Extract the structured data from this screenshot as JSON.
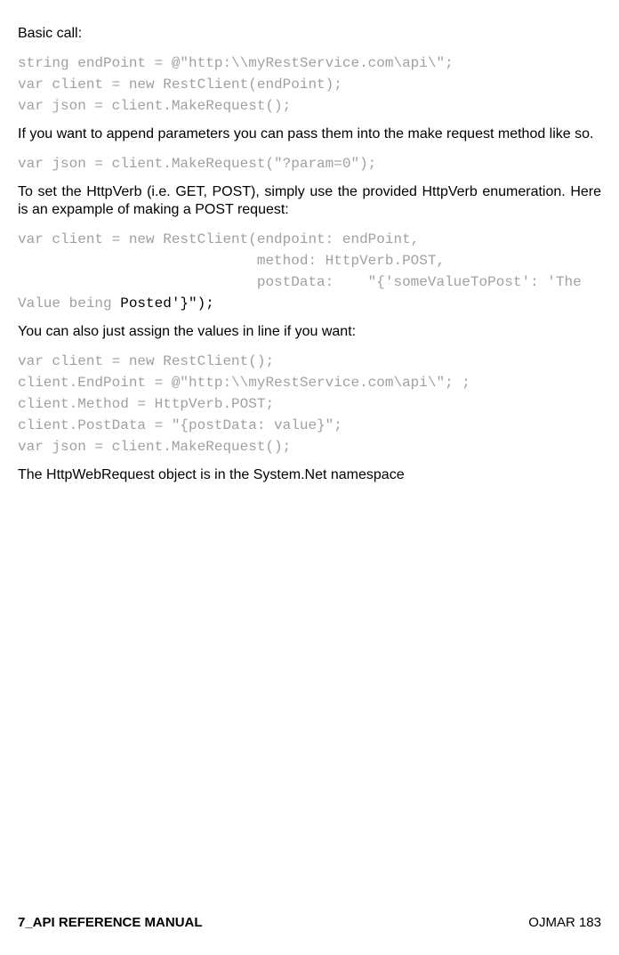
{
  "p1": "Basic call:",
  "code1": "string endPoint = @\"http:\\\\myRestService.com\\api\\\";\nvar client = new RestClient(endPoint);\nvar json = client.MakeRequest();",
  "p2": "If you want to append parameters you can pass them into the make request method like so.",
  "code2": "var json = client.MakeRequest(\"?param=0\");",
  "p3": "To set the HttpVerb (i.e. GET, POST), simply use the provided HttpVerb enumeration. Here is an expample of making a POST request:",
  "code3_l1": "var client = new RestClient(endpoint: endPoint,",
  "code3_l2": "                            method: HttpVerb.POST,",
  "code3_l3a": "                            postData:    \"{'someValueToPost': 'The Value being ",
  "code3_l3b": "Posted'}\");",
  "p4": "You can also just assign the values in line if you want:",
  "code4": "var client = new RestClient();\nclient.EndPoint = @\"http:\\\\myRestService.com\\api\\\"; ;\nclient.Method = HttpVerb.POST;\nclient.PostData = \"{postData: value}\";\nvar json = client.MakeRequest();",
  "p5": "The HttpWebRequest object is in the System.Net namespace",
  "footer_left": "7_API REFERENCE MANUAL",
  "footer_right": "OJMAR 183"
}
